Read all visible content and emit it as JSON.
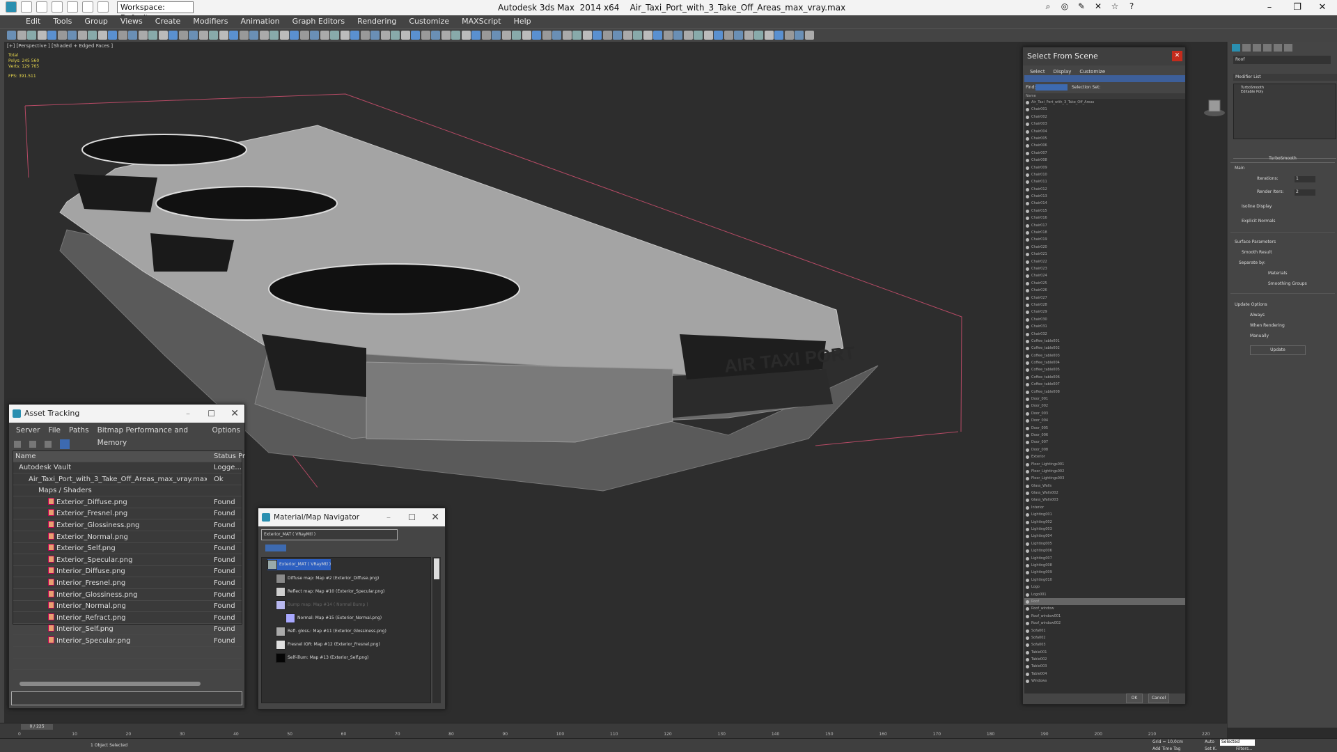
{
  "titlebar": {
    "workspace": "Workspace: Default",
    "app": "Autodesk 3ds Max  2014 x64",
    "file": "Air_Taxi_Port_with_3_Take_Off_Areas_max_vray.max",
    "minimize": "–",
    "restore": "❐",
    "close": "✕"
  },
  "menu": [
    "Edit",
    "Tools",
    "Group",
    "Views",
    "Create",
    "Modifiers",
    "Animation",
    "Graph Editors",
    "Rendering",
    "Customize",
    "MAXScript",
    "Help"
  ],
  "viewport": {
    "label": "[+] [Perspective ] [Shaded + Edged Faces ]",
    "stats": {
      "total": "Total",
      "polys_label": "Polys:",
      "polys": "245 560",
      "verts_label": "Verts:",
      "verts": "129 765",
      "fps_label": "FPS:",
      "fps": "391.511"
    },
    "sign_text": "AIR TAXI PORT"
  },
  "asset_tracking": {
    "title": "Asset Tracking",
    "menu": [
      "Server",
      "File",
      "Paths",
      "Bitmap Performance and Memory",
      "Options"
    ],
    "columns": [
      "Name",
      "Status",
      "Pr"
    ],
    "rows": [
      {
        "name": "Autodesk Vault",
        "status": "Logge...",
        "indent": 0
      },
      {
        "name": "Air_Taxi_Port_with_3_Take_Off_Areas_max_vray.max",
        "status": "Ok",
        "indent": 1
      },
      {
        "name": "Maps / Shaders",
        "status": "",
        "indent": 2
      },
      {
        "name": "Exterior_Diffuse.png",
        "status": "Found",
        "indent": 3
      },
      {
        "name": "Exterior_Fresnel.png",
        "status": "Found",
        "indent": 3
      },
      {
        "name": "Exterior_Glossiness.png",
        "status": "Found",
        "indent": 3
      },
      {
        "name": "Exterior_Normal.png",
        "status": "Found",
        "indent": 3
      },
      {
        "name": "Exterior_Self.png",
        "status": "Found",
        "indent": 3
      },
      {
        "name": "Exterior_Specular.png",
        "status": "Found",
        "indent": 3
      },
      {
        "name": "Interior_Diffuse.png",
        "status": "Found",
        "indent": 3
      },
      {
        "name": "Interior_Fresnel.png",
        "status": "Found",
        "indent": 3
      },
      {
        "name": "Interior_Glossiness.png",
        "status": "Found",
        "indent": 3
      },
      {
        "name": "Interior_Normal.png",
        "status": "Found",
        "indent": 3
      },
      {
        "name": "Interior_Refract.png",
        "status": "Found",
        "indent": 3
      },
      {
        "name": "Interior_Self.png",
        "status": "Found",
        "indent": 3
      },
      {
        "name": "Interior_Specular.png",
        "status": "Found",
        "indent": 3
      }
    ]
  },
  "material_navigator": {
    "title": "Material/Map Navigator",
    "current": "Exterior_MAT  ( VRayMtl )",
    "root": "Exterior_MAT  ( VRayMtl )",
    "items": [
      {
        "label": "Diffuse map: Map #2 (Exterior_Diffuse.png)",
        "swatch": "#8a8a8a"
      },
      {
        "label": "Reflect map: Map #10 (Exterior_Specular.png)",
        "swatch": "#cfcfcf"
      },
      {
        "label": "Bump map: Map #14 ( Normal Bump )",
        "swatch": "#b8b8f0"
      },
      {
        "label": "Normal: Map #15 (Exterior_Normal.png)",
        "swatch": "#a8a8ff"
      },
      {
        "label": "Refl. gloss.: Map #11 (Exterior_Glossiness.png)",
        "swatch": "#aaaaaa"
      },
      {
        "label": "Fresnel IOR: Map #12 (Exterior_Fresnel.png)",
        "swatch": "#e0e0e0"
      },
      {
        "label": "Self-illum: Map #13 (Exterior_Self.png)",
        "swatch": "#050505"
      }
    ]
  },
  "select_from_scene": {
    "title": "Select From Scene",
    "menu": [
      "Select",
      "Display",
      "Customize"
    ],
    "find_label": "Find:",
    "selection_set": "Selection Set:",
    "column": "Name",
    "objects": [
      "Air_Taxi_Port_with_3_Take_Off_Areas",
      "Chair001",
      "Chair002",
      "Chair003",
      "Chair004",
      "Chair005",
      "Chair006",
      "Chair007",
      "Chair008",
      "Chair009",
      "Chair010",
      "Chair011",
      "Chair012",
      "Chair013",
      "Chair014",
      "Chair015",
      "Chair016",
      "Chair017",
      "Chair018",
      "Chair019",
      "Chair020",
      "Chair021",
      "Chair022",
      "Chair023",
      "Chair024",
      "Chair025",
      "Chair026",
      "Chair027",
      "Chair028",
      "Chair029",
      "Chair030",
      "Chair031",
      "Chair032",
      "Coffee_table001",
      "Coffee_table002",
      "Coffee_table003",
      "Coffee_table004",
      "Coffee_table005",
      "Coffee_table006",
      "Coffee_table007",
      "Coffee_table008",
      "Door_001",
      "Door_002",
      "Door_003",
      "Door_004",
      "Door_005",
      "Door_006",
      "Door_007",
      "Door_008",
      "Exterior",
      "Floor_Lightings001",
      "Floor_Lightings002",
      "Floor_Lightings003",
      "Glass_Walls",
      "Glass_Walls002",
      "Glass_Walls003",
      "Interior",
      "Lighting001",
      "Lighting002",
      "Lighting003",
      "Lighting004",
      "Lighting005",
      "Lighting006",
      "Lighting007",
      "Lighting008",
      "Lighting009",
      "Lighting010",
      "Logo",
      "Logo001",
      "Roof",
      "Roof_window",
      "Roof_window001",
      "Roof_window002",
      "Sofa001",
      "Sofa002",
      "Sofa003",
      "Table001",
      "Table002",
      "Table003",
      "Table004",
      "Windows"
    ],
    "selected": "Roof",
    "ok": "OK",
    "cancel": "Cancel"
  },
  "command_panel": {
    "object_name": "Roof",
    "modifier_list": "Modifier List",
    "stack": [
      "TurboSmooth",
      "Editable Poly"
    ],
    "rollout": "TurboSmooth",
    "main": "Main",
    "iterations_label": "Iterations:",
    "iterations": "1",
    "render_iters_label": "Render Iters:",
    "render_iters": "2",
    "isoline": "Isoline Display",
    "explicit": "Explicit Normals",
    "surface": "Surface Parameters",
    "smooth_result": "Smooth Result",
    "separate": "Separate by:",
    "materials": "Materials",
    "smoothing_groups": "Smoothing Groups",
    "update_options": "Update Options",
    "always": "Always",
    "when_rendering": "When Rendering",
    "manually": "Manually",
    "update": "Update"
  },
  "timeline": {
    "frame": "0 / 225",
    "ticks": [
      "0",
      "10",
      "20",
      "30",
      "40",
      "50",
      "60",
      "70",
      "80",
      "90",
      "100",
      "110",
      "120",
      "130",
      "140",
      "150",
      "160",
      "170",
      "180",
      "190",
      "200",
      "210",
      "220"
    ]
  },
  "status": {
    "objects": "1 Object Selected",
    "grid": "Grid = 10,0cm",
    "add_tag": "Add Time Tag",
    "selected": "Selected",
    "auto": "Auto",
    "setk": "Set K.",
    "filters": "Filters..."
  }
}
